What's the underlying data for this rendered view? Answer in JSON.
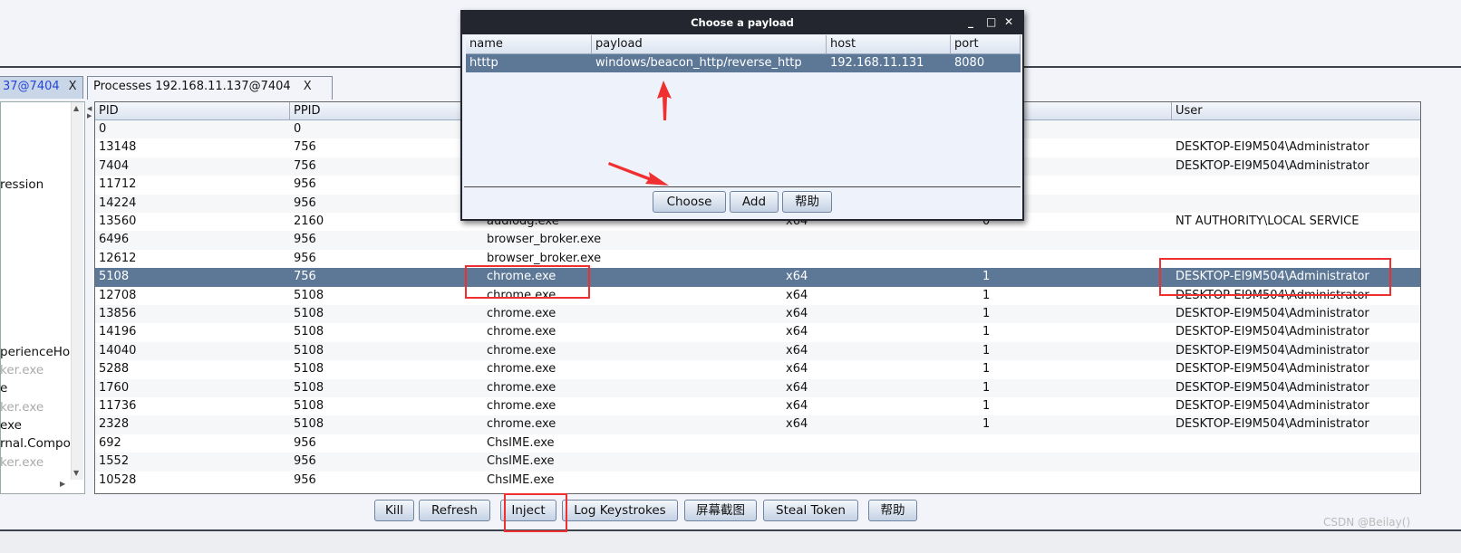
{
  "tabs": [
    {
      "label": "37@7404",
      "close": "X",
      "active": false
    },
    {
      "label": "Processes 192.168.11.137@7404",
      "close": "X",
      "active": true
    }
  ],
  "left_panel": {
    "items": [
      {
        "text": "ression",
        "muted": false
      },
      {
        "text": "perienceHo",
        "muted": false
      },
      {
        "text": "ker.exe",
        "muted": true
      },
      {
        "text": "e",
        "muted": false
      },
      {
        "text": "ker.exe",
        "muted": true
      },
      {
        "text": "exe",
        "muted": false
      },
      {
        "text": "rnal.Compo",
        "muted": false
      },
      {
        "text": "ker.exe",
        "muted": true
      }
    ]
  },
  "process_table": {
    "columns": [
      "PID",
      "PPID",
      "",
      "",
      "",
      "User"
    ],
    "selected_index": 8,
    "rows": [
      [
        "0",
        "0",
        "",
        "",
        "",
        ""
      ],
      [
        "13148",
        "756",
        "",
        "",
        "",
        "DESKTOP-EI9M504\\Administrator"
      ],
      [
        "7404",
        "756",
        "",
        "",
        "",
        "DESKTOP-EI9M504\\Administrator"
      ],
      [
        "11712",
        "956",
        "",
        "",
        "",
        ""
      ],
      [
        "14224",
        "956",
        "",
        "",
        "",
        ""
      ],
      [
        "13560",
        "2160",
        "audiodg.exe",
        "x64",
        "0",
        "NT AUTHORITY\\LOCAL SERVICE"
      ],
      [
        "6496",
        "956",
        "browser_broker.exe",
        "",
        "",
        ""
      ],
      [
        "12612",
        "956",
        "browser_broker.exe",
        "",
        "",
        ""
      ],
      [
        "5108",
        "756",
        "chrome.exe",
        "x64",
        "1",
        "DESKTOP-EI9M504\\Administrator"
      ],
      [
        "12708",
        "5108",
        "chrome.exe",
        "x64",
        "1",
        "DESKTOP-EI9M504\\Administrator"
      ],
      [
        "13856",
        "5108",
        "chrome.exe",
        "x64",
        "1",
        "DESKTOP-EI9M504\\Administrator"
      ],
      [
        "14196",
        "5108",
        "chrome.exe",
        "x64",
        "1",
        "DESKTOP-EI9M504\\Administrator"
      ],
      [
        "14040",
        "5108",
        "chrome.exe",
        "x64",
        "1",
        "DESKTOP-EI9M504\\Administrator"
      ],
      [
        "5288",
        "5108",
        "chrome.exe",
        "x64",
        "1",
        "DESKTOP-EI9M504\\Administrator"
      ],
      [
        "1760",
        "5108",
        "chrome.exe",
        "x64",
        "1",
        "DESKTOP-EI9M504\\Administrator"
      ],
      [
        "11736",
        "5108",
        "chrome.exe",
        "x64",
        "1",
        "DESKTOP-EI9M504\\Administrator"
      ],
      [
        "2328",
        "5108",
        "chrome.exe",
        "x64",
        "1",
        "DESKTOP-EI9M504\\Administrator"
      ],
      [
        "692",
        "956",
        "ChsIME.exe",
        "",
        "",
        ""
      ],
      [
        "1552",
        "956",
        "ChsIME.exe",
        "",
        "",
        ""
      ],
      [
        "10528",
        "956",
        "ChsIME.exe",
        "",
        "",
        ""
      ]
    ]
  },
  "buttons": {
    "kill": "Kill",
    "refresh": "Refresh",
    "inject": "Inject",
    "log_keystrokes": "Log Keystrokes",
    "screenshot": "屏幕截图",
    "steal_token": "Steal Token",
    "help": "帮助"
  },
  "dialog": {
    "title": "Choose a payload",
    "columns": [
      "name",
      "payload",
      "host",
      "port"
    ],
    "rows": [
      [
        "htttp",
        "windows/beacon_http/reverse_http",
        "192.168.11.131",
        "8080"
      ]
    ],
    "buttons": {
      "choose": "Choose",
      "add": "Add",
      "help": "帮助"
    }
  },
  "watermark": "CSDN @Beilay()",
  "colors": {
    "selection": "#5d7896",
    "annotation": "#f03030",
    "titlebar": "#23262e"
  }
}
